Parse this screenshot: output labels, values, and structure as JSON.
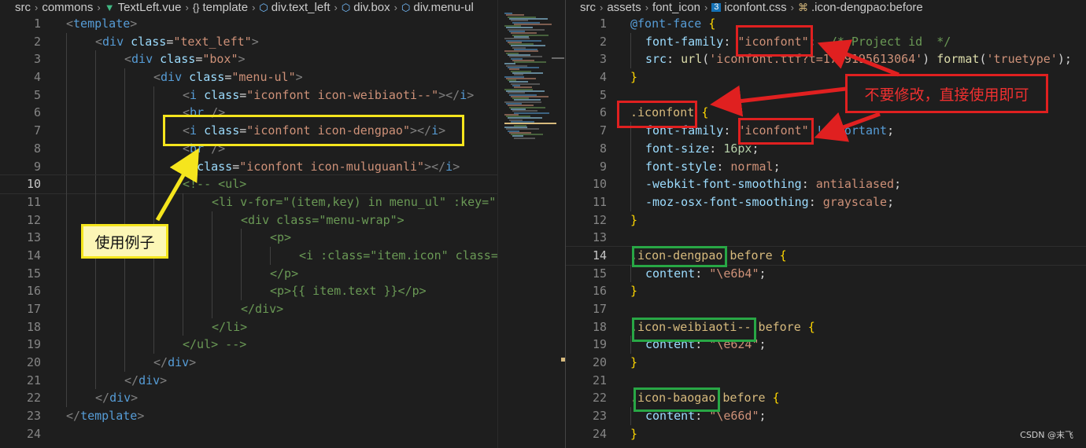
{
  "left_editor": {
    "breadcrumb": [
      {
        "text": "src",
        "icon": ""
      },
      {
        "text": "commons",
        "icon": ""
      },
      {
        "text": "TextLeft.vue",
        "icon": "vue-icon"
      },
      {
        "text": "template",
        "icon": "braces-icon"
      },
      {
        "text": "div.text_left",
        "icon": "cube-icon"
      },
      {
        "text": "div.box",
        "icon": "cube-icon"
      },
      {
        "text": "div.menu-ul",
        "icon": "cube-icon"
      }
    ],
    "current_line": 10,
    "lines": [
      {
        "n": "1",
        "indent": 0,
        "tokens": [
          [
            "tg",
            "<"
          ],
          [
            "tn",
            "template"
          ],
          [
            "tg",
            ">"
          ]
        ]
      },
      {
        "n": "2",
        "indent": 1,
        "tokens": [
          [
            "tg",
            "<"
          ],
          [
            "tn",
            "div"
          ],
          [
            "tx",
            " "
          ],
          [
            "an",
            "class"
          ],
          [
            "tx",
            "="
          ],
          [
            "av",
            "\"text_left\""
          ],
          [
            "tg",
            ">"
          ]
        ]
      },
      {
        "n": "3",
        "indent": 2,
        "tokens": [
          [
            "tg",
            "<"
          ],
          [
            "tn",
            "div"
          ],
          [
            "tx",
            " "
          ],
          [
            "an",
            "class"
          ],
          [
            "tx",
            "="
          ],
          [
            "av",
            "\"box\""
          ],
          [
            "tg",
            ">"
          ]
        ]
      },
      {
        "n": "4",
        "indent": 3,
        "tokens": [
          [
            "tg",
            "<"
          ],
          [
            "tn",
            "div"
          ],
          [
            "tx",
            " "
          ],
          [
            "an",
            "class"
          ],
          [
            "tx",
            "="
          ],
          [
            "av",
            "\"menu-ul\""
          ],
          [
            "tg",
            ">"
          ]
        ]
      },
      {
        "n": "5",
        "indent": 4,
        "tokens": [
          [
            "tg",
            "<"
          ],
          [
            "tn",
            "i"
          ],
          [
            "tx",
            " "
          ],
          [
            "an",
            "class"
          ],
          [
            "tx",
            "="
          ],
          [
            "av",
            "\"iconfont icon-weibiaoti--\""
          ],
          [
            "tg",
            "></"
          ],
          [
            "tn",
            "i"
          ],
          [
            "tg",
            ">"
          ]
        ]
      },
      {
        "n": "6",
        "indent": 4,
        "tokens": [
          [
            "tg",
            "<"
          ],
          [
            "tn",
            "br"
          ],
          [
            "tx",
            " "
          ],
          [
            "tg",
            "/>"
          ]
        ]
      },
      {
        "n": "7",
        "indent": 4,
        "tokens": [
          [
            "tg",
            "<"
          ],
          [
            "tn",
            "i"
          ],
          [
            "tx",
            " "
          ],
          [
            "an",
            "class"
          ],
          [
            "tx",
            "="
          ],
          [
            "av",
            "\"iconfont icon-dengpao\""
          ],
          [
            "tg",
            "></"
          ],
          [
            "tn",
            "i"
          ],
          [
            "tg",
            ">"
          ]
        ]
      },
      {
        "n": "8",
        "indent": 4,
        "tokens": [
          [
            "tg",
            "<"
          ],
          [
            "tn",
            "br"
          ],
          [
            "tx",
            " "
          ],
          [
            "tg",
            "/>"
          ]
        ]
      },
      {
        "n": "9",
        "indent": 4,
        "tokens": [
          [
            "tx",
            "  "
          ],
          [
            "an",
            "class"
          ],
          [
            "tx",
            "="
          ],
          [
            "av",
            "\"iconfont icon-muluguanli\""
          ],
          [
            "tg",
            "></"
          ],
          [
            "tn",
            "i"
          ],
          [
            "tg",
            ">"
          ]
        ]
      },
      {
        "n": "10",
        "indent": 4,
        "tokens": [
          [
            "cm",
            "<!-- <ul>"
          ]
        ]
      },
      {
        "n": "11",
        "indent": 5,
        "tokens": [
          [
            "cm",
            "<li v-for=\"(item,key) in menu_ul\" :key=\""
          ]
        ]
      },
      {
        "n": "12",
        "indent": 6,
        "tokens": [
          [
            "cm",
            "<div class=\"menu-wrap\">"
          ]
        ]
      },
      {
        "n": "13",
        "indent": 7,
        "tokens": [
          [
            "cm",
            "<p>"
          ]
        ]
      },
      {
        "n": "14",
        "indent": 8,
        "tokens": [
          [
            "cm",
            "<i :class=\"item.icon\" class="
          ]
        ]
      },
      {
        "n": "15",
        "indent": 7,
        "tokens": [
          [
            "cm",
            "</p>"
          ]
        ]
      },
      {
        "n": "16",
        "indent": 7,
        "tokens": [
          [
            "cm",
            "<p>{{ item.text }}</p>"
          ]
        ]
      },
      {
        "n": "17",
        "indent": 6,
        "tokens": [
          [
            "cm",
            "</div>"
          ]
        ]
      },
      {
        "n": "18",
        "indent": 5,
        "tokens": [
          [
            "cm",
            "</li>"
          ]
        ]
      },
      {
        "n": "19",
        "indent": 4,
        "tokens": [
          [
            "cm",
            "</ul> -->"
          ]
        ]
      },
      {
        "n": "20",
        "indent": 3,
        "tokens": [
          [
            "tg",
            "</"
          ],
          [
            "tn",
            "div"
          ],
          [
            "tg",
            ">"
          ]
        ]
      },
      {
        "n": "21",
        "indent": 2,
        "tokens": [
          [
            "tg",
            "</"
          ],
          [
            "tn",
            "div"
          ],
          [
            "tg",
            ">"
          ]
        ]
      },
      {
        "n": "22",
        "indent": 1,
        "tokens": [
          [
            "tg",
            "</"
          ],
          [
            "tn",
            "div"
          ],
          [
            "tg",
            ">"
          ]
        ]
      },
      {
        "n": "23",
        "indent": 0,
        "tokens": [
          [
            "tg",
            "</"
          ],
          [
            "tn",
            "template"
          ],
          [
            "tg",
            ">"
          ]
        ]
      },
      {
        "n": "24",
        "indent": 0,
        "tokens": []
      }
    ]
  },
  "right_editor": {
    "breadcrumb": [
      {
        "text": "src",
        "icon": ""
      },
      {
        "text": "assets",
        "icon": ""
      },
      {
        "text": "font_icon",
        "icon": ""
      },
      {
        "text": "iconfont.css",
        "icon": "css-icon"
      },
      {
        "text": ".icon-dengpao:before",
        "icon": "selector-icon"
      }
    ],
    "current_line": 14,
    "lines": [
      {
        "n": "1",
        "indent": 0,
        "tokens": [
          [
            "kw",
            "@font-face"
          ],
          [
            "pn",
            " "
          ],
          [
            "br",
            "{"
          ]
        ]
      },
      {
        "n": "2",
        "indent": 1,
        "tokens": [
          [
            "pr",
            "font-family"
          ],
          [
            "pn",
            ": "
          ],
          [
            "vl",
            "\"iconfont\""
          ],
          [
            "pn",
            ";  "
          ],
          [
            "cm",
            "/* Project id  */"
          ]
        ]
      },
      {
        "n": "3",
        "indent": 1,
        "tokens": [
          [
            "pr",
            "src"
          ],
          [
            "pn",
            ": "
          ],
          [
            "fn",
            "url"
          ],
          [
            "pn",
            "("
          ],
          [
            "vl",
            "'iconfont.ttf?t=1709195613064'"
          ],
          [
            "pn",
            ") "
          ],
          [
            "fn",
            "format"
          ],
          [
            "pn",
            "("
          ],
          [
            "vl",
            "'truetype'"
          ],
          [
            "pn",
            ");"
          ]
        ]
      },
      {
        "n": "4",
        "indent": 0,
        "tokens": [
          [
            "br",
            "}"
          ]
        ]
      },
      {
        "n": "5",
        "indent": 0,
        "tokens": []
      },
      {
        "n": "6",
        "indent": 0,
        "tokens": [
          [
            "sel",
            ".iconfont"
          ],
          [
            "pn",
            " "
          ],
          [
            "br",
            "{"
          ]
        ]
      },
      {
        "n": "7",
        "indent": 1,
        "tokens": [
          [
            "pr",
            "font-family"
          ],
          [
            "pn",
            ": "
          ],
          [
            "vl",
            "\"iconfont\""
          ],
          [
            "pn",
            " "
          ],
          [
            "kw",
            "!important"
          ],
          [
            "pn",
            ";"
          ]
        ]
      },
      {
        "n": "8",
        "indent": 1,
        "tokens": [
          [
            "pr",
            "font-size"
          ],
          [
            "pn",
            ": "
          ],
          [
            "num",
            "16px"
          ],
          [
            "pn",
            ";"
          ]
        ]
      },
      {
        "n": "9",
        "indent": 1,
        "tokens": [
          [
            "pr",
            "font-style"
          ],
          [
            "pn",
            ": "
          ],
          [
            "vl",
            "normal"
          ],
          [
            "pn",
            ";"
          ]
        ]
      },
      {
        "n": "10",
        "indent": 1,
        "tokens": [
          [
            "pr",
            "-webkit-font-smoothing"
          ],
          [
            "pn",
            ": "
          ],
          [
            "vl",
            "antialiased"
          ],
          [
            "pn",
            ";"
          ]
        ]
      },
      {
        "n": "11",
        "indent": 1,
        "tokens": [
          [
            "pr",
            "-moz-osx-font-smoothing"
          ],
          [
            "pn",
            ": "
          ],
          [
            "vl",
            "grayscale"
          ],
          [
            "pn",
            ";"
          ]
        ]
      },
      {
        "n": "12",
        "indent": 0,
        "tokens": [
          [
            "br",
            "}"
          ]
        ]
      },
      {
        "n": "13",
        "indent": 0,
        "tokens": []
      },
      {
        "n": "14",
        "indent": 0,
        "tokens": [
          [
            "sel",
            ".icon-dengpao:before"
          ],
          [
            "pn",
            " "
          ],
          [
            "br",
            "{"
          ]
        ]
      },
      {
        "n": "15",
        "indent": 1,
        "tokens": [
          [
            "pr",
            "content"
          ],
          [
            "pn",
            ": "
          ],
          [
            "vl",
            "\"\\e6b4\""
          ],
          [
            "pn",
            ";"
          ]
        ]
      },
      {
        "n": "16",
        "indent": 0,
        "tokens": [
          [
            "br",
            "}"
          ]
        ]
      },
      {
        "n": "17",
        "indent": 0,
        "tokens": []
      },
      {
        "n": "18",
        "indent": 0,
        "tokens": [
          [
            "sel",
            ".icon-weibiaoti--:before"
          ],
          [
            "pn",
            " "
          ],
          [
            "br",
            "{"
          ]
        ]
      },
      {
        "n": "19",
        "indent": 1,
        "tokens": [
          [
            "pr",
            "content"
          ],
          [
            "pn",
            ": "
          ],
          [
            "vl",
            "\"\\e624\""
          ],
          [
            "pn",
            ";"
          ]
        ]
      },
      {
        "n": "20",
        "indent": 0,
        "tokens": [
          [
            "br",
            "}"
          ]
        ]
      },
      {
        "n": "21",
        "indent": 0,
        "tokens": []
      },
      {
        "n": "22",
        "indent": 0,
        "tokens": [
          [
            "sel",
            ".icon-baogao:before"
          ],
          [
            "pn",
            " "
          ],
          [
            "br",
            "{"
          ]
        ]
      },
      {
        "n": "23",
        "indent": 1,
        "tokens": [
          [
            "pr",
            "content"
          ],
          [
            "pn",
            ": "
          ],
          [
            "vl",
            "\"\\e66d\""
          ],
          [
            "pn",
            ";"
          ]
        ]
      },
      {
        "n": "24",
        "indent": 0,
        "tokens": [
          [
            "br",
            "}"
          ]
        ]
      }
    ]
  },
  "annotations": {
    "usage_label": "使用例子",
    "note_label": "不要修改，直接使用即可"
  },
  "colors": {
    "yellow": "#f5e51d",
    "red": "#e02020",
    "green": "#28a745",
    "editor_bg": "#1e1e1e"
  },
  "watermark": "CSDN @末飞"
}
